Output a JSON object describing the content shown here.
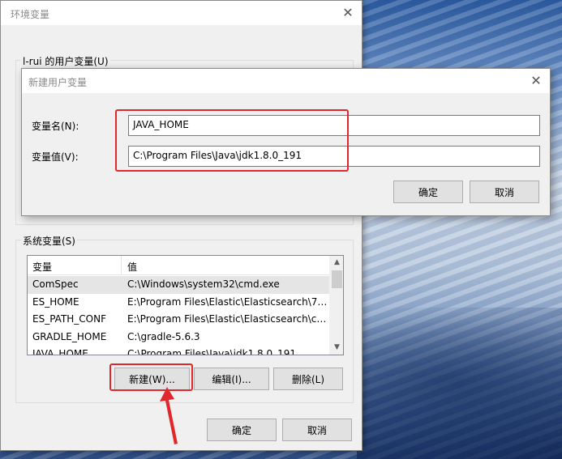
{
  "main_window": {
    "title": "环境变量",
    "user_group_label": "l-rui 的用户变量(U)",
    "system_group_label": "系统变量(S)",
    "list": {
      "columns": [
        "变量",
        "值"
      ],
      "rows": [
        {
          "name": "ComSpec",
          "value": "C:\\Windows\\system32\\cmd.exe"
        },
        {
          "name": "ES_HOME",
          "value": "E:\\Program Files\\Elastic\\Elasticsearch\\7...."
        },
        {
          "name": "ES_PATH_CONF",
          "value": "E:\\Program Files\\Elastic\\Elasticsearch\\co..."
        },
        {
          "name": "GRADLE_HOME",
          "value": "C:\\gradle-5.6.3"
        },
        {
          "name": "JAVA_HOME",
          "value": "C:\\Program Files\\Java\\jdk1.8.0_191"
        }
      ],
      "selected_index": 0
    },
    "buttons": {
      "new": "新建(W)...",
      "edit": "编辑(I)...",
      "delete": "删除(L)",
      "ok": "确定",
      "cancel": "取消"
    }
  },
  "new_dialog": {
    "title": "新建用户变量",
    "name_label": "变量名(N):",
    "name_value": "JAVA_HOME",
    "value_label": "变量值(V):",
    "value_value": "C:\\Program Files\\Java\\jdk1.8.0_191",
    "buttons": {
      "ok": "确定",
      "cancel": "取消"
    }
  },
  "icons": {
    "close": "close-icon",
    "scroll_up": "chevron-up-icon",
    "scroll_down": "chevron-down-icon"
  },
  "colors": {
    "highlight": "#e0282c",
    "dialog_bg": "#f0f0f0"
  }
}
